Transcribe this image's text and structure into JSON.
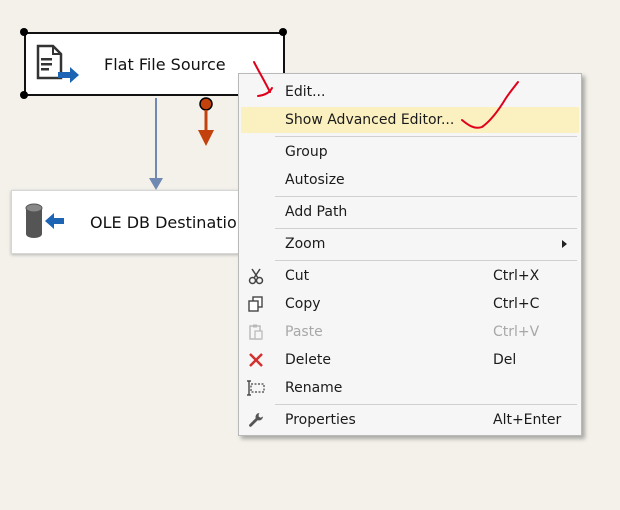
{
  "canvas": {
    "source_node": {
      "label": "Flat File Source",
      "icon": "flat-file-source-icon"
    },
    "destination_node": {
      "label": "OLE DB Destination",
      "icon": "ole-db-destination-icon"
    }
  },
  "context_menu": {
    "items": [
      {
        "label": "Edit...",
        "shortcut": "",
        "icon": ""
      },
      {
        "label": "Show Advanced Editor...",
        "shortcut": "",
        "icon": "",
        "highlighted": true
      },
      {
        "label": "Group",
        "shortcut": "",
        "icon": ""
      },
      {
        "label": "Autosize",
        "shortcut": "",
        "icon": ""
      },
      {
        "label": "Add Path",
        "shortcut": "",
        "icon": ""
      },
      {
        "label": "Zoom",
        "shortcut": "",
        "icon": "",
        "submenu": true
      },
      {
        "label": "Cut",
        "shortcut": "Ctrl+X",
        "icon": "scissors-icon"
      },
      {
        "label": "Copy",
        "shortcut": "Ctrl+C",
        "icon": "copy-icon"
      },
      {
        "label": "Paste",
        "shortcut": "Ctrl+V",
        "icon": "paste-icon",
        "disabled": true
      },
      {
        "label": "Delete",
        "shortcut": "Del",
        "icon": "delete-x-icon"
      },
      {
        "label": "Rename",
        "shortcut": "",
        "icon": "rename-icon"
      },
      {
        "label": "Properties",
        "shortcut": "Alt+Enter",
        "icon": "wrench-icon"
      }
    ]
  },
  "colors": {
    "canvas_bg": "#f3f1ea",
    "data_path_blue": "#6f89b2",
    "error_path_red": "#c2410c",
    "menu_highlight": "#fbf0c0",
    "annotation_red": "#e0001b",
    "delete_red": "#d32f2f"
  }
}
